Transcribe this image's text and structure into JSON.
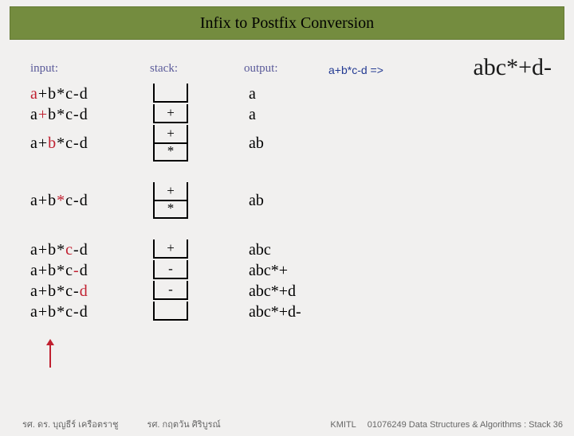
{
  "title": "Infix to Postfix Conversion",
  "headers": {
    "input": "input",
    "stack": "stack",
    "output": "output"
  },
  "target": "a+b*c-d =>",
  "result": "abc*+d-",
  "steps": [
    {
      "expr": [
        [
          "hl",
          "a"
        ],
        [
          "",
          "+b*c-d"
        ]
      ],
      "stack": [
        ""
      ],
      "output": "a"
    },
    {
      "expr": [
        [
          "",
          "a"
        ],
        [
          "hl",
          "+"
        ],
        [
          "",
          "b*c-d"
        ]
      ],
      "stack": [
        "+"
      ],
      "output": "a"
    },
    {
      "expr": [
        [
          "",
          "a+"
        ],
        [
          "hl",
          "b"
        ],
        [
          "",
          "*c-d"
        ]
      ],
      "stack": [
        "+",
        "*"
      ],
      "output": "ab",
      "gapAfter": true
    },
    {
      "expr": [
        [
          "",
          "a+b"
        ],
        [
          "hl",
          "*"
        ],
        [
          "",
          "c-d"
        ]
      ],
      "stack": [
        "+",
        "*"
      ],
      "output": "ab",
      "gapAfter": true
    },
    {
      "expr": [
        [
          "",
          "a+b*"
        ],
        [
          "hl",
          "c"
        ],
        [
          "",
          "-d"
        ]
      ],
      "stack": [
        "+"
      ],
      "output": "abc"
    },
    {
      "expr": [
        [
          "",
          "a+b*c"
        ],
        [
          "hl",
          "-"
        ],
        [
          "",
          "d"
        ]
      ],
      "stack": [
        "-"
      ],
      "output": "abc*+"
    },
    {
      "expr": [
        [
          "",
          "a+b*c-"
        ],
        [
          "hl",
          "d"
        ]
      ],
      "stack": [
        "-"
      ],
      "output": "abc*+d"
    },
    {
      "expr": [
        [
          "",
          "a+b*c-d"
        ]
      ],
      "stack": [
        ""
      ],
      "output": "abc*+d-"
    }
  ],
  "footer": {
    "left": "รศ. ดร. บุญธีร์    เครือตราชู",
    "mid": "รศ. กฤตวัน   ศิริบูรณ์",
    "inst": "KMITL",
    "right": "01076249 Data Structures & Algorithms : Stack 36"
  }
}
